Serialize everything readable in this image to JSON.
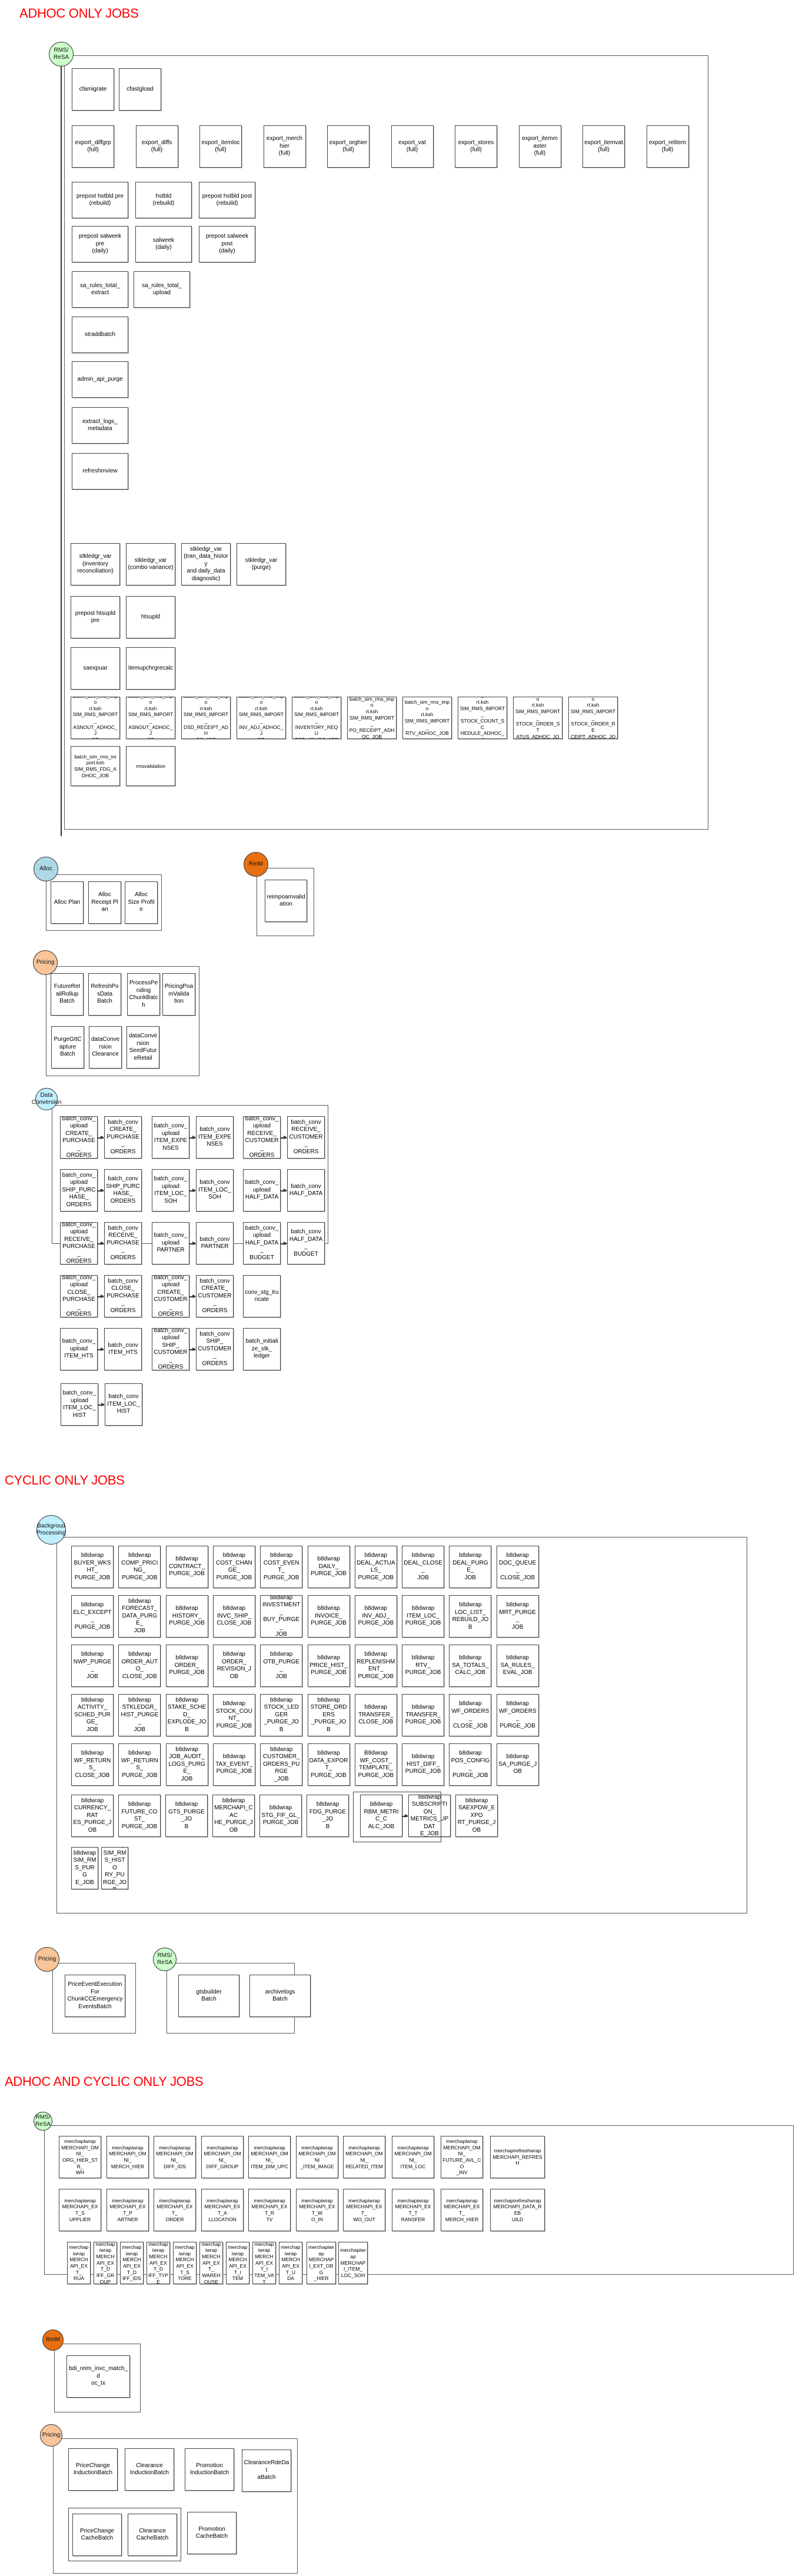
{
  "sections": {
    "adhoc": {
      "title": "ADHOC ONLY JOBS",
      "rms": {
        "label": "RMS/\nReSA",
        "rows": [
          [
            "cfamigrate",
            "cfastgload"
          ],
          [
            "export_diffgrp\n(full)",
            "export_diffs\n(full)",
            "export_itemloc\n(full)",
            "export_merchhier\n(full)",
            "export_orghier\n(full)",
            "export_vat\n(full)",
            "export_stores\n(full)",
            "export_itemmaster\n(full)",
            "export_itemvat\n(full)",
            "export_relitem\n(full)"
          ],
          [
            "prepost hstbld pre\n(rebuild)",
            "hstbld\n(rebuild)",
            "prepost hstbld post\n(rebuild)"
          ],
          [
            "prepost salweek\npre\n(daily)",
            "salweek\n(daily)",
            "prepost salweek\npost\n(daily)"
          ],
          [
            "sa_rules_total_\nextract",
            "sa_rules_total_\nupload"
          ],
          [
            "straddbatch"
          ],
          [
            "admin_api_purge"
          ],
          [
            "extract_logs_\nmetadata"
          ],
          [
            "refreshmview"
          ],
          [
            "stkledgr_var\n(inventory\nreconciliation)",
            "stkledgr_var\n(combo variance)",
            "stkledgr_var\n(tran_data_history\nand daily_data\ndiagnostic)",
            "stkledgr_var\n(purge)"
          ],
          [
            "prepost htsupld\npre",
            "htsupld"
          ],
          [
            "saexpuar",
            "itemupchrgrecalc"
          ],
          [
            "batch_sim_rms_impo\nrt.ksh\nSIM_RMS_IMPORT_\nASNOUT_ADHOC_J\nOB",
            "batch_sim_rms_impo\nrt.ksh\nSIM_RMS_IMPORT_\nASNOUT_ADHOC_J\nOB",
            "batch_sim_rms_impo\nrt.ksh\nSIM_RMS_IMPORT_\nDSD_RECEIPT_ADH\nOC_JOB",
            "batch_sim_rms_impo\nrt.ksh\nSIM_RMS_IMPORT_\nINV_ADJ_ADHOC_J\nOB",
            "batch_sim_rms_impo\nrt.ksh\nSIM_RMS_IMPORT_\nINVENTORY_REQU\nEST_ADHOC_JOB",
            "batch_sim_rms_impo\nrt.ksh\nSIM_RMS_IMPORT_\nPO_RECEIPT_ADH\nOC_JOB",
            "batch_sim_rms_impo\nrt.ksh\nSIM_RMS_IMPORT_\nRTV_ADHOC_JOB",
            "batch_sim_rms_impo\nrt.ksh\nSIM_RMS_IMPORT_\nSTOCK_COUNT_SC\nHEDULE_ADHOC_J\nOB",
            "batch_sim_rms_impo\nrt.ksh\nSIM_RMS_IMPORT_\nSTOCK_ORDER_ST\nATUS_ADHOC_JOB",
            "batch_sim_rms_impo\nrt.ksh\nSIM_RMS_IMPORT_\nSTOCK_ORDER_RE\nCEIPT_ADHOC_JOB"
          ],
          [
            "batch_sim_rms_im\nport.ksh\nSIM_RMS_FDG_A\nDHOC_JOB",
            "rmsvalidation"
          ]
        ]
      },
      "alloc": {
        "label": "Alloc",
        "items": [
          "Alloc Plan",
          "Alloc\nReceipt Plan",
          "Alloc\nSize Profile"
        ]
      },
      "reim": {
        "label": "ReIM",
        "items": [
          "reimpoamvalidation"
        ]
      },
      "pricing": {
        "label": "Pricing",
        "rows": [
          [
            "FutureRetailRollup\nBatch",
            "RefreshPosData\nBatch",
            "ProcessPending\nChunkBatch",
            "PricingPoamValida\ntion"
          ],
          [
            "PurgeGttCapture\nBatch",
            "dataConversion\nClearance",
            "dataConversion\nSeedFutureRetail"
          ]
        ]
      },
      "conversion": {
        "label": "Data\nConversion",
        "pairs": [
          [
            "batch_conv_upload\nCREATE_\nPURCHASE_\nORDERS",
            "batch_conv\nCREATE_\nPURCHASE_\nORDERS"
          ],
          [
            "batch_conv_upload\nITEM_EXPENSES",
            "batch_conv\nITEM_EXPENSES"
          ],
          [
            "batch_conv_upload\nRECEIVE_\nCUSTOMER_\nORDERS",
            "batch_conv\nRECEIVE_\nCUSTOMER_\nORDERS"
          ],
          [
            "batch_conv_upload\nSHIP_PURCHASE_\nORDERS",
            "batch_conv\nSHIP_PURCHASE_\nORDERS"
          ],
          [
            "batch_conv_upload\nITEM_LOC_SOH",
            "batch_conv\nITEM_LOC_SOH"
          ],
          [
            "batch_conv_upload\nHALF_DATA",
            "batch_conv\nHALF_DATA"
          ],
          [
            "batch_conv_upload\nRECEIVE_\nPURCHASE_\nORDERS",
            "batch_conv\nRECEIVE_\nPURCHASE_\nORDERS"
          ],
          [
            "batch_conv_upload\nPARTNER",
            "batch_conv\nPARTNER"
          ],
          [
            "batch_conv_upload\nHALF_DATA_\nBUDGET",
            "batch_conv\nHALF_DATA_\nBUDGET"
          ],
          [
            "batch_conv_upload\nCLOSE_\nPURCHASE_\nORDERS",
            "batch_conv\nCLOSE_\nPURCHASE_\nORDERS"
          ],
          [
            "batch_conv_upload\nCREATE_\nCUSTOMER_\nORDERS",
            "batch_conv\nCREATE_\nCUSTOMER_\nORDERS"
          ],
          [
            "batch_conv_upload\nITEM_HTS",
            "batch_conv\nITEM_HTS"
          ],
          [
            "batch_conv_upload\nSHIP_\nCUSTOMER_\nORDERS",
            "batch_conv\nSHIP_\nCUSTOMER_\nORDERS"
          ],
          [
            "batch_conv_upload\nITEM_LOC_HIST",
            "batch_conv\nITEM_LOC_HIST"
          ]
        ],
        "singles": [
          "conv_stg_truncate",
          "batch_initialize_stk_\nledger"
        ]
      }
    },
    "cyclic": {
      "title": "CYCLIC ONLY JOBS",
      "bg": {
        "label": "Backgroud\nProcessing",
        "rows": [
          [
            "b8dwrap\nBUYER_WKSHT_\nPURGE_JOB",
            "b8dwrap\nCOMP_PRICING_\nPURGE_JOB",
            "b8dwrap\nCONTRACT_\nPURGE_JOB",
            "b8dwrap\nCOST_CHANGE_\nPURGE_JOB",
            "b8dwrap\nCOST_EVENT_\nPURGE_JOB",
            "b8dwrap\nDAILY_\nPURGE_JOB",
            "b8dwrap\nDEAL_ACTUALS_\nPURGE_JOB",
            "b8dwrap\nDEAL_CLOSE_\nJOB",
            "b8dwrap\nDEAL_PURGE_\nJOB",
            "b8dwrap\nDOC_QUEUE_\nCLOSE_JOB"
          ],
          [
            "b8dwrap\nELC_EXCEPT_\nPURGE_JOB",
            "b8dwrap\nFORECAST_\nDATA_PURGE_\nJOB",
            "b8dwrap\nHISTORY_\nPURGE_JOB",
            "b8dwrap\nINVC_SHIP_\nCLOSE_JOB",
            "b8dwrap\nINVESTMENT_\nBUY_PURGE_\nJOB",
            "b8dwrap\nINVOICE_\nPURGE_JOB",
            "b8dwrap\nINV_ADJ_\nPURGE_JOB",
            "b8dwrap\nITEM_LOC_\nPURGE_JOB",
            "b8dwrap\nLOC_LIST_\nREBUILD_JOB",
            "b8dwrap\nMRT_PURGE_\nJOB"
          ],
          [
            "b8dwrap\nNWP_PURGE_\nJOB",
            "b8dwrap\nORDER_AUTO_\nCLOSE_JOB",
            "b8dwrap\nORDER_\nPURGE_JOB",
            "b8dwrap\nORDER_\nREVISION_JOB",
            "b8dwrap\nOTB_PURGE_\nJOB",
            "b8dwrap\nPRICE_HIST_\nPURGE_JOB",
            "b8dwrap\nREPLENISHMENT_\nPURGE_JOB",
            "b8dwrap\nRTV_\nPURGE_JOB",
            "b8dwrap\nSA_TOTALS_\nCALC_JOB",
            "b8dwrap\nSA_RULES_\nEVAL_JOB"
          ],
          [
            "b8dwrap\nACTIVITY_\nSCHED_PURGE_\nJOB",
            "b8dwrap\nSTKLEDGR_\nHIST_PURGE_\nJOB",
            "b8dwrap\nSTAKE_SCHED_\nEXPLODE_JOB",
            "b8dwrap\nSTOCK_COUNT_\nPURGE_JOB",
            "b8dwrap\nSTOCK_LEDGER\n_PURGE_JOB",
            "b8dwrap\nSTORE_ORDERS\n_PURGE_JOB",
            "b8dwrap\nTRANSFER_\nCLOSE_JOB",
            "b8dwrap\nTRANSFER_\nPURGE_JOB",
            "b8dwrap\nWF_ORDERS_\nCLOSE_JOB",
            "b8dwrap\nWF_ORDERS_\nPURGE_JOB"
          ],
          [
            "b8dwrap\nWF_RETURNS_\nCLOSE_JOB",
            "b8dwrap\nWF_RETURNS_\nPURGE_JOB",
            "b8dwrap\nJOB_AUDIT_\nLOGS_PURGE_\nJOB",
            "b8dwrap\nTAX_EVENT_\nPURGE_JOB",
            "b8dwrap\nCUSTOMER_\nORDERS_PURGE\n_JOB",
            "b8dwrap\nDATA_EXPORT_\nPURGE_JOB",
            "B8dwrap\nWF_COST_\nTEMPLATE_\nPURGE_JOB",
            "b8dwrap\nHIST_DIFF_\nPURGE_JOB",
            "b8dwrap\nPOS_CONFIG_\nPURGE_JOB",
            "b8dwrap\nSA_PURGE_JOB"
          ],
          [
            "b8dwrap\nCURRENCY_RAT\nES_PURGE_JOB",
            "b8dwrap\nFUTURE_COST_\nPURGE_JOB",
            "b8dwrap\nGTS_PURGE_JO\nB",
            "b8dwrap\nMERCHAPI_CAC\nHE_PURGE_JOB",
            "b8dwrap\nSTG_FIF_GL_\nPURGE_JOB",
            "b8dwrap\nFDG_PURGE_JO\nB",
            "b8dwrap\nRBM_METRIC_C\nALC_JOB",
            "b8dwrap\nSUBSCRIPTION_\nMETRICS_UPDAT\nE_JOB",
            "b8dwrap\nSAEXPDW_EXPO\nRT_PURGE_JOB"
          ],
          [
            "b8dwrap\nSIM_RMS_PURG\nE_JOB",
            "b8dwrap\nSIM_RMS_HISTO\nRY_PURGE_JOB"
          ]
        ]
      },
      "pricing": {
        "label": "Pricing",
        "items": [
          "PriceEventExecutionFor\nChunkCCEmergency\nEventsBatch"
        ]
      },
      "rms": {
        "label": "RMS/\nReSA",
        "items": [
          "gtsbuilder\nBatch",
          "archivelogs\nBatch"
        ]
      }
    },
    "both": {
      "title": "ADHOC AND CYCLIC ONLY JOBS",
      "rms": {
        "label": "RMS/\nReSA",
        "rows": [
          [
            "merchapiwrap\nMERCHAPI_OMNI_\nORG_HIER_STR_\nWH",
            "merchapiwrap\nMERCHAPI_OMNI_\nMERCH_HIER",
            "merchapiwrap\nMERCHAPI_OMNI_\nDIFF_IDS",
            "merchapiwrap\nMERCHAPI_OMNI_\nDIFF_GROUP",
            "merchapiwrap\nMERCHAPI_OMNI_\nITEM_DIM_UPC",
            "merchapiwrap\nMERCHAPI_OMNI\n_ITEM_IMAGE",
            "merchapiwrap\nMERCHAPI_OMNI_\nRELATED_ITEM",
            "merchapiwrap\nMERCHAPI_OMNI_\nITEM_LOC",
            "merchapiwrap\nMERCHAPI_OMNI_\nFUTURE_AVL_CO\n_INV",
            "merchapirefreshwrap\nMERCHAPI_REFRESH"
          ],
          [
            "merchapiwrap\nMERCHAPI_EXT_S\nUPPLIER",
            "merchapiwrap\nMERCHAPI_EXT_P\nARTNER",
            "merchapiwrap\nMERCHAPI_EXT_\nORDER",
            "merchapiwrap\nMERCHAPI_EXT_A\nLLOCATION",
            "merchapiwrap\nMERCHAPI_EXT_R\nTV",
            "merchapiwrap\nMERCHAPI_EXT_W\nO_IN",
            "merchapiwrap\nMERCHAPI_EXT_\nWO_OUT",
            "merchapiwrap\nMERCHAPI_EXT_T\nRANSFER",
            "merchapiwrap\nMERCHAPI_EXT_\nMERCH_HIER",
            "merchapirefreshwrap\nMERCHAPI_DATA_REB\nUILD"
          ],
          [
            "merchapiwrap\nMERCHAPI_EXT_\nRUA",
            "merchapiwrap\nMERCHAPI_EXT_D\nIFF_GROUP",
            "merchapiwrap\nMERCHAPI_EXT_D\nIFF_IDS",
            "merchapiwrap\nMERCHAPI_EXT_D\nIFF_TYPE",
            "merchapiwrap\nMERCHAPI_EXT_S\nTORE",
            "merchapiwrap\nMERCHAPI_EXT_\nWAREHOUSE",
            "merchapiwrap\nMERCHAPI_EXT_I\nTEM",
            "merchapiwrap\nMERCHAPI_EXT_I\nTEM_VAT",
            "merchapiwrap\nMERCHAPI_EXT_U\nDA",
            "merchapiwrap\nMERCHAPI_EXT_ORG\n_HIER",
            "merchapiwrap\nMERCHAPI_ITEM_\nLOC_SOH"
          ]
        ]
      },
      "reim": {
        "label": "ReIM",
        "items": [
          "bdi_reim_invc_match_d\noc_tx"
        ]
      },
      "pricing": {
        "label": "Pricing",
        "rows": [
          [
            "PriceChange\nInductionBatch",
            "Clearance\nInductionBatch",
            "Promotion\nInductionBatch",
            "ClearanceRdeDat\naBatch"
          ],
          [
            "PriceChange\nCacheBatch",
            "Clearance\nCacheBatch",
            "Promotion\nCacheBatch"
          ]
        ]
      }
    }
  },
  "colors": {
    "heading": "#ff0000",
    "rms": "#ccffcc",
    "alloc": "#add8e6",
    "reim": "#e87010",
    "pricing": "#f8c49a",
    "conversion": "#bfefff",
    "background": "#bfefff"
  }
}
